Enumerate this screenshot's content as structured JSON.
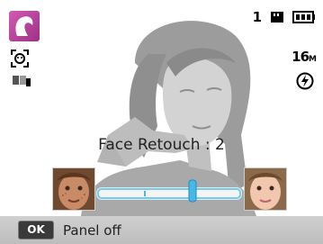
{
  "status": {
    "shot_count": "1",
    "resolution": "16",
    "resolution_unit": "M"
  },
  "retouch": {
    "label": "Face Retouch : 2",
    "level": 2,
    "min": 0,
    "max": 3
  },
  "panel": {
    "ok_key": "OK",
    "label": "Panel off"
  },
  "icons": {
    "mode": "beauty-face-mode-icon",
    "face_detect": "face-detection-icon",
    "metering": "metering-icon",
    "memory": "memory-card-icon",
    "battery": "battery-icon",
    "flash": "flash-off-icon"
  },
  "colors": {
    "mode_accent": "#b8449e",
    "slider_border": "#7ac9ea",
    "panel_bg": "#c6c6c6"
  }
}
